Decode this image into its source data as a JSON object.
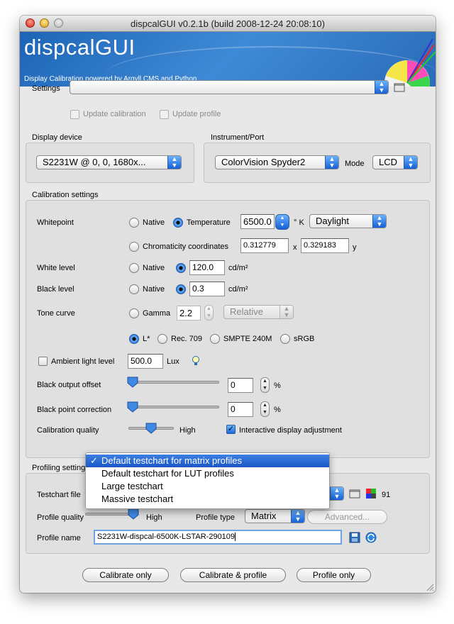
{
  "window": {
    "title": "dispcalGUI v0.2.1b (build 2008-12-24 20:08:10)",
    "banner_title": "dispcalGUI",
    "banner_subtitle": "Display Calibration powered by Argyll CMS and Python"
  },
  "settings": {
    "label": "Settings",
    "value": "",
    "update_calibration": "Update calibration",
    "update_profile": "Update profile"
  },
  "display": {
    "group_label": "Display device",
    "value": "S2231W @ 0, 0, 1680x..."
  },
  "instrument": {
    "group_label": "Instrument/Port",
    "value": "ColorVision Spyder2",
    "mode_label": "Mode",
    "mode_value": "LCD"
  },
  "calibration": {
    "group_label": "Calibration settings",
    "whitepoint": {
      "label": "Whitepoint",
      "native": "Native",
      "temperature": "Temperature",
      "temperature_value": "6500.0",
      "kelvin_unit": "° K",
      "type_value": "Daylight",
      "chromaticity": "Chromaticity coordinates",
      "x_value": "0.312779",
      "x_label": "x",
      "y_value": "0.329183",
      "y_label": "y"
    },
    "white_level": {
      "label": "White level",
      "native": "Native",
      "value": "120.0",
      "unit": "cd/m²"
    },
    "black_level": {
      "label": "Black level",
      "native": "Native",
      "value": "0.3",
      "unit": "cd/m²"
    },
    "tone_curve": {
      "label": "Tone curve",
      "gamma": "Gamma",
      "gamma_value": "2.2",
      "gamma_type": "Relative",
      "options": [
        "L*",
        "Rec. 709",
        "SMPTE 240M",
        "sRGB"
      ]
    },
    "ambient": {
      "label": "Ambient light level",
      "value": "500.0",
      "unit": "Lux"
    },
    "black_output_offset": {
      "label": "Black output offset",
      "value": "0",
      "unit": "%",
      "slider_fraction": 0
    },
    "black_point_correction": {
      "label": "Black point correction",
      "value": "0",
      "unit": "%",
      "slider_fraction": 0
    },
    "quality": {
      "label": "Calibration quality",
      "value": "High",
      "slider_fraction": 0.5
    },
    "interactive": "Interactive display adjustment"
  },
  "profiling": {
    "group_label": "Profiling settings",
    "testchart_label": "Testchart file",
    "testchart_count": "91",
    "quality_label": "Profile quality",
    "quality_value": "High",
    "quality_slider_fraction": 1,
    "type_label": "Profile type",
    "type_value": "Matrix",
    "advanced": "Advanced...",
    "name_label": "Profile name",
    "name_value": "S2231W-dispcal-6500K-LSTAR-290109"
  },
  "testchart_menu": {
    "items": [
      "Default testchart for matrix profiles",
      "Default testchart for LUT profiles",
      "Large testchart",
      "Massive testchart"
    ],
    "selected_mark": "✓"
  },
  "buttons": {
    "calibrate_only": "Calibrate only",
    "calibrate_profile": "Calibrate & profile",
    "profile_only": "Profile only"
  },
  "colors": {
    "accent": "#1b68d8",
    "banner": "#2f7fd0",
    "window_bg": "#e8e8e8",
    "menu_highlight": "#2a66d4"
  }
}
